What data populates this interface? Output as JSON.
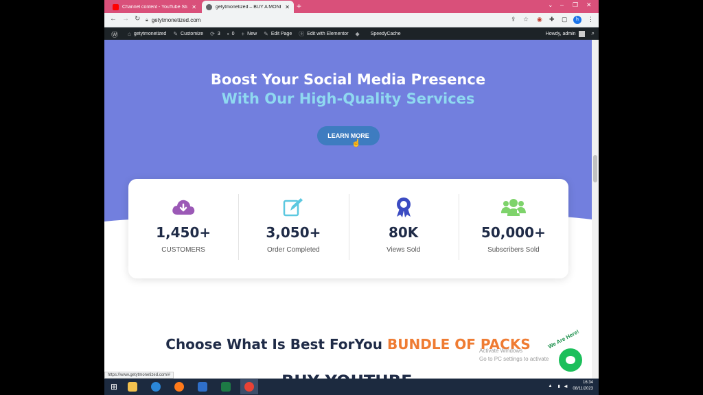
{
  "browser": {
    "tabs": [
      {
        "title": "Channel content - YouTube Studio",
        "favicon_color": "#ff0000"
      },
      {
        "title": "getytmonetized – BUY A MONETIZED",
        "favicon_color": "#5f6368"
      }
    ],
    "url": "getytmonetized.com",
    "profile_initial": "h"
  },
  "adminbar": {
    "site": "getytmonetized",
    "customize": "Customize",
    "updates_count": "3",
    "comments_count": "0",
    "new": "New",
    "edit_page": "Edit Page",
    "elementor": "Edit with Elementor",
    "cache": "SpeedyCache",
    "howdy": "Howdy, admin"
  },
  "hero": {
    "title": "Boost Your Social Media Presence",
    "subtitle": "With Our High-Quality Services",
    "button": "LEARN MORE",
    "bg_color": "#727fde"
  },
  "stats": [
    {
      "icon": "cloud-download-icon",
      "color": "#9b59b6",
      "value": "1,450+",
      "label": "CUSTOMERS"
    },
    {
      "icon": "edit-icon",
      "color": "#5bc8e0",
      "value": "3,050+",
      "label": "Order Completed"
    },
    {
      "icon": "award-ribbon-icon",
      "color": "#3b4bc2",
      "value": "80K",
      "label": "Views Sold"
    },
    {
      "icon": "users-icon",
      "color": "#7ed36b",
      "value": "50,000+",
      "label": "Subscribers Sold"
    }
  ],
  "section": {
    "title_main": "Choose What Is Best ForYou",
    "title_accent": "BUNDLE OF PACKS",
    "next_title": "BUY YOUTUBE"
  },
  "overlay": {
    "activate_line1": "Activate Windows",
    "activate_line2": "Go to PC settings to activate",
    "chat_badge": "We Are Here!",
    "status_url": "https://www.getytmonetized.com/#"
  },
  "taskbar": {
    "time": "16:34",
    "date": "08/11/2023"
  }
}
